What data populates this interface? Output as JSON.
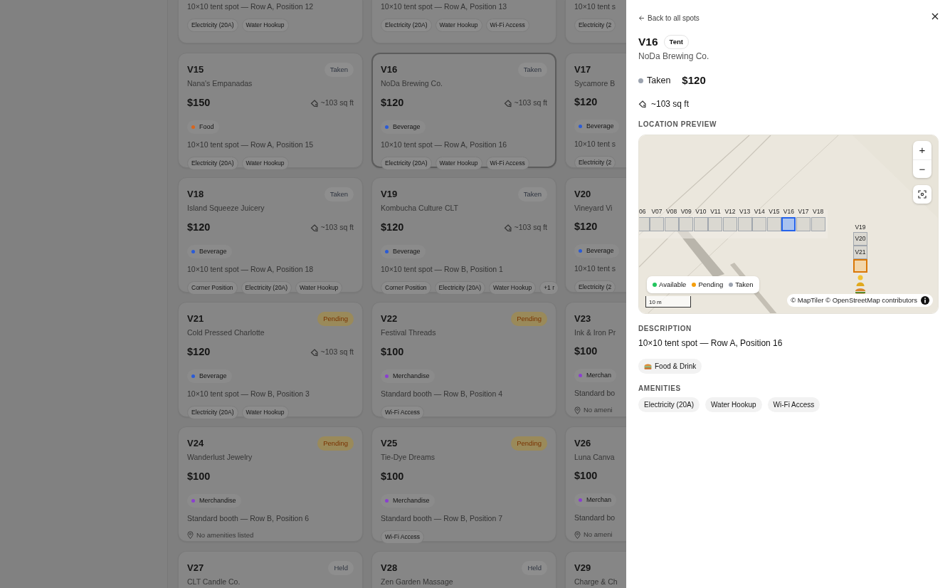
{
  "spot_rows": [
    {
      "cards": [
        {
          "description": "10×10 tent spot — Row A, Position 12",
          "amenities": [
            "Electricity (20A)",
            "Water Hookup"
          ]
        },
        {
          "description": "10×10 tent spot — Row A, Position 13",
          "amenities": [
            "Electricity (20A)",
            "Water Hookup",
            "Wi-Fi Access"
          ]
        },
        {
          "description": "10×10 tent s",
          "amenities": [
            "Electricity (2"
          ]
        }
      ]
    },
    {
      "cards": [
        {
          "spot": "V15",
          "vendor": "Nana's Empanadas",
          "status": {
            "label": "Taken",
            "kind": "taken"
          },
          "price": "$150",
          "area": "~103 sq ft",
          "category": {
            "label": "Food",
            "color": "#d9651c"
          },
          "description": "10×10 tent spot — Row A, Position 15",
          "amenities": [
            "Electricity (20A)",
            "Water Hookup"
          ],
          "selected": false
        },
        {
          "spot": "V16",
          "vendor": "NoDa Brewing Co.",
          "status": {
            "label": "Taken",
            "kind": "taken"
          },
          "price": "$120",
          "area": "~103 sq ft",
          "category": {
            "label": "Beverage",
            "color": "#2a5bd7"
          },
          "description": "10×10 tent spot — Row A, Position 16",
          "amenities": [
            "Electricity (20A)",
            "Water Hookup",
            "Wi-Fi Access"
          ],
          "selected": true
        },
        {
          "spot": "V17",
          "vendor": "Sycamore B",
          "price": "$120",
          "category": {
            "label": "Beverage",
            "color": "#2a5bd7"
          },
          "description": "10×10 tent s",
          "amenities": [
            "Electricity (2"
          ]
        }
      ]
    },
    {
      "cards": [
        {
          "spot": "V18",
          "vendor": "Island Squeeze Juicery",
          "status": {
            "label": "Taken",
            "kind": "taken"
          },
          "price": "$120",
          "area": "~103 sq ft",
          "category": {
            "label": "Beverage",
            "color": "#2a5bd7"
          },
          "description": "10×10 tent spot — Row A, Position 18",
          "amenities": [
            "Corner Position",
            "Electricity (20A)",
            "Water Hookup"
          ],
          "selected": false
        },
        {
          "spot": "V19",
          "vendor": "Kombucha Culture CLT",
          "status": {
            "label": "Taken",
            "kind": "taken"
          },
          "price": "$120",
          "area": "~103 sq ft",
          "category": {
            "label": "Beverage",
            "color": "#2a5bd7"
          },
          "description": "10×10 tent spot — Row B, Position 1",
          "amenities": [
            "Corner Position",
            "Electricity (20A)",
            "Water Hookup",
            "+1 r"
          ],
          "selected": false
        },
        {
          "spot": "V20",
          "vendor": "Vineyard Vi",
          "price": "$120",
          "category": {
            "label": "Beverage",
            "color": "#2a5bd7"
          },
          "description": "10×10 tent s",
          "amenities": [
            "Electricity (2"
          ]
        }
      ]
    },
    {
      "cards": [
        {
          "spot": "V21",
          "vendor": "Cold Pressed Charlotte",
          "status": {
            "label": "Pending",
            "kind": "pending"
          },
          "price": "$120",
          "area": "~103 sq ft",
          "category": {
            "label": "Beverage",
            "color": "#2a5bd7"
          },
          "description": "10×10 tent spot — Row B, Position 3",
          "amenities": [
            "Electricity (20A)",
            "Water Hookup"
          ],
          "selected": false
        },
        {
          "spot": "V22",
          "vendor": "Festival Threads",
          "status": {
            "label": "Pending",
            "kind": "pending"
          },
          "price": "$100",
          "category": {
            "label": "Merchandise",
            "color": "#8b3fd0"
          },
          "description": "Standard booth — Row B, Position 4",
          "amenities": [
            "Wi-Fi Access"
          ],
          "selected": false
        },
        {
          "spot": "V23",
          "vendor": "Ink & Iron Pr",
          "price": "$100",
          "category": {
            "label": "Merchan",
            "color": "#8b3fd0"
          },
          "description": "Standard bo",
          "no_amenities": "No ameni"
        }
      ]
    },
    {
      "cards": [
        {
          "spot": "V24",
          "vendor": "Wanderlust Jewelry",
          "status": {
            "label": "Pending",
            "kind": "pending"
          },
          "price": "$100",
          "category": {
            "label": "Merchandise",
            "color": "#8b3fd0"
          },
          "description": "Standard booth — Row B, Position 6",
          "no_amenities": "No amenities listed",
          "selected": false
        },
        {
          "spot": "V25",
          "vendor": "Tie-Dye Dreams",
          "status": {
            "label": "Pending",
            "kind": "pending"
          },
          "price": "$100",
          "category": {
            "label": "Merchandise",
            "color": "#8b3fd0"
          },
          "description": "Standard booth — Row B, Position 7",
          "amenities": [
            "Wi-Fi Access"
          ],
          "selected": false
        },
        {
          "spot": "V26",
          "vendor": "Luna Canva",
          "price": "$100",
          "category": {
            "label": "Merchan",
            "color": "#8b3fd0"
          },
          "description": "Standard bo",
          "no_amenities": "No ameni"
        }
      ]
    },
    {
      "cards": [
        {
          "spot": "V27",
          "vendor": "CLT Candle Co.",
          "status": {
            "label": "Held",
            "kind": "held"
          },
          "selected": false
        },
        {
          "spot": "V28",
          "vendor": "Zen Garden Massage",
          "status": {
            "label": "Held",
            "kind": "held"
          },
          "selected": false
        },
        {
          "spot": "V29",
          "vendor": "Charge & Ch"
        }
      ]
    }
  ],
  "detail": {
    "back_link": "Back to all spots",
    "title": "V16",
    "type_badge": "Tent",
    "vendor": "NoDa Brewing Co.",
    "status": {
      "label": "Taken",
      "kind": "taken"
    },
    "price": "$120",
    "area": "~103 sq ft",
    "location_heading": "LOCATION PREVIEW",
    "map": {
      "row_spots": [
        {
          "label": "06",
          "kind": "taken",
          "selected": false
        },
        {
          "label": "V07",
          "kind": "taken",
          "selected": false
        },
        {
          "label": "V08",
          "kind": "taken",
          "selected": false
        },
        {
          "label": "V09",
          "kind": "taken",
          "selected": false
        },
        {
          "label": "V10",
          "kind": "taken",
          "selected": false
        },
        {
          "label": "V11",
          "kind": "taken",
          "selected": false
        },
        {
          "label": "V12",
          "kind": "taken",
          "selected": false
        },
        {
          "label": "V13",
          "kind": "taken",
          "selected": false
        },
        {
          "label": "V14",
          "kind": "taken",
          "selected": false
        },
        {
          "label": "V15",
          "kind": "taken",
          "selected": false
        },
        {
          "label": "V16",
          "kind": "taken",
          "selected": true
        },
        {
          "label": "V17",
          "kind": "taken",
          "selected": false
        },
        {
          "label": "V18",
          "kind": "taken",
          "selected": false
        }
      ],
      "column_heading": "V19",
      "column_spots": [
        {
          "label": "V20",
          "kind": "taken",
          "selected": false
        },
        {
          "label": "V21",
          "kind": "taken",
          "selected": false
        },
        {
          "kind": "pending",
          "selected": false
        }
      ],
      "zoom_in": "+",
      "zoom_out": "−",
      "legend": [
        {
          "label": "Available",
          "color": "#22c55e"
        },
        {
          "label": "Pending",
          "color": "#f59e0b"
        },
        {
          "label": "Taken",
          "color": "#9ca3af"
        }
      ],
      "scale": "10 m",
      "attribution": "© MapTiler © OpenStreetMap contributors"
    },
    "description_heading": "DESCRIPTION",
    "description": "10×10 tent spot — Row A, Position 16",
    "category": "Food & Drink",
    "amenities_heading": "AMENITIES",
    "amenities": [
      "Electricity (20A)",
      "Water Hookup",
      "Wi-Fi Access"
    ]
  }
}
